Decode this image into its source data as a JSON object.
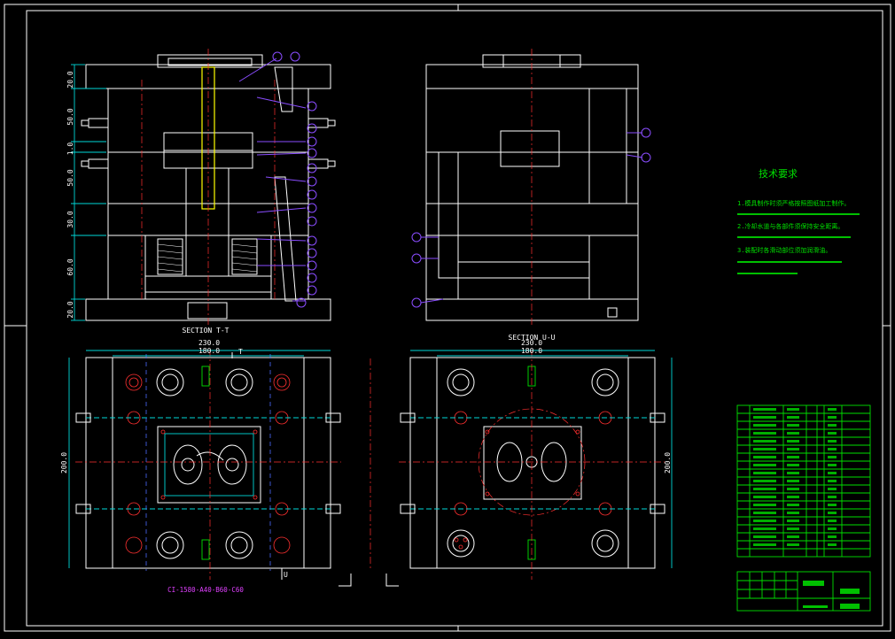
{
  "drawing": {
    "section_tt": "SECTION T-T",
    "section_uu": "SECTION U-U",
    "part_code": "CI-1580-A40-B60-C60",
    "tech_title": "技术要求",
    "tech_lines": [
      "1.模具制作时须严格按照图纸加工制作。",
      "2.冷却水道与各部件须保持安全距离。",
      "3.装配时各滑动部位须加润滑油。"
    ],
    "dims_left_height": [
      "20.0",
      "50.0",
      "1.0",
      "50.0",
      "30.0",
      "60.0",
      "20.0"
    ],
    "dims_bottom": {
      "width_outer": "230.0",
      "width_inner": "180.0",
      "height_left": "200.0",
      "height_right": "200.0"
    },
    "dims_bottom_right": {
      "width_outer": "230.0",
      "width_inner": "180.0"
    },
    "section_mark_t": "T",
    "section_mark_u": "U"
  },
  "colors": {
    "background": "#000000",
    "outline": "#ffffff",
    "dimension": "#00d8d8",
    "table": "#00e000",
    "centerline": "#ff3030",
    "sprue": "#ffff00",
    "callout": "#8a4dff"
  }
}
